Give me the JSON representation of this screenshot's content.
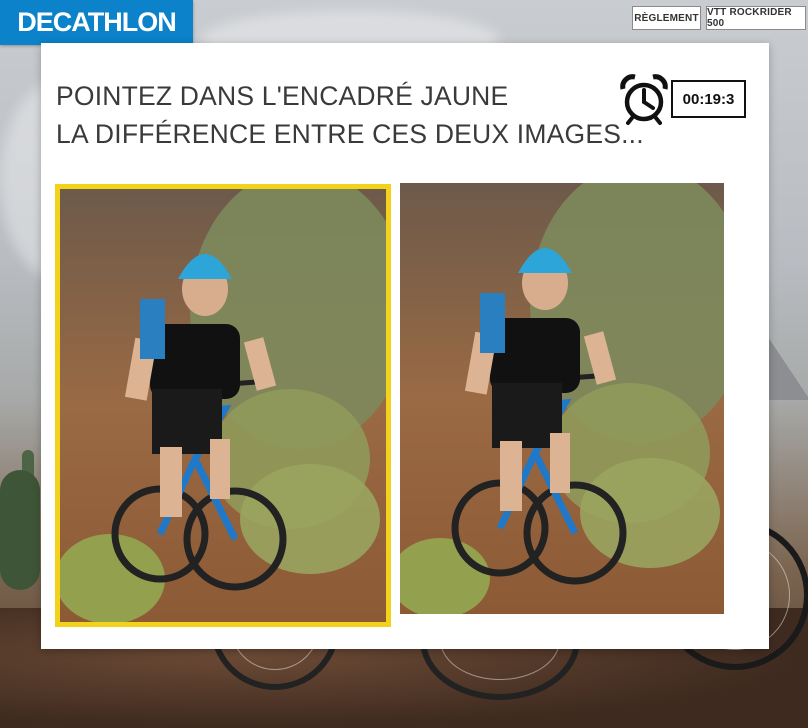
{
  "brand": {
    "logo_text": "DECATHLON",
    "color": "#0b82c9"
  },
  "header": {
    "buttons": [
      {
        "label": "RÈGLEMENT"
      },
      {
        "label": "VTT ROCKRIDER 500"
      }
    ]
  },
  "game": {
    "instruction_line1": "POINTEZ DANS L'ENCADRÉ JAUNE",
    "instruction_line2": "LA DIFFÉRENCE ENTRE CES DEUX IMAGES...",
    "timer": "00:19:3",
    "highlight_color": "#f2d21b",
    "images": [
      {
        "name": "left-image",
        "subject": "mountain biker in blue helmet",
        "highlighted": true
      },
      {
        "name": "right-image",
        "subject": "mountain biker in blue helmet",
        "highlighted": false
      }
    ]
  }
}
